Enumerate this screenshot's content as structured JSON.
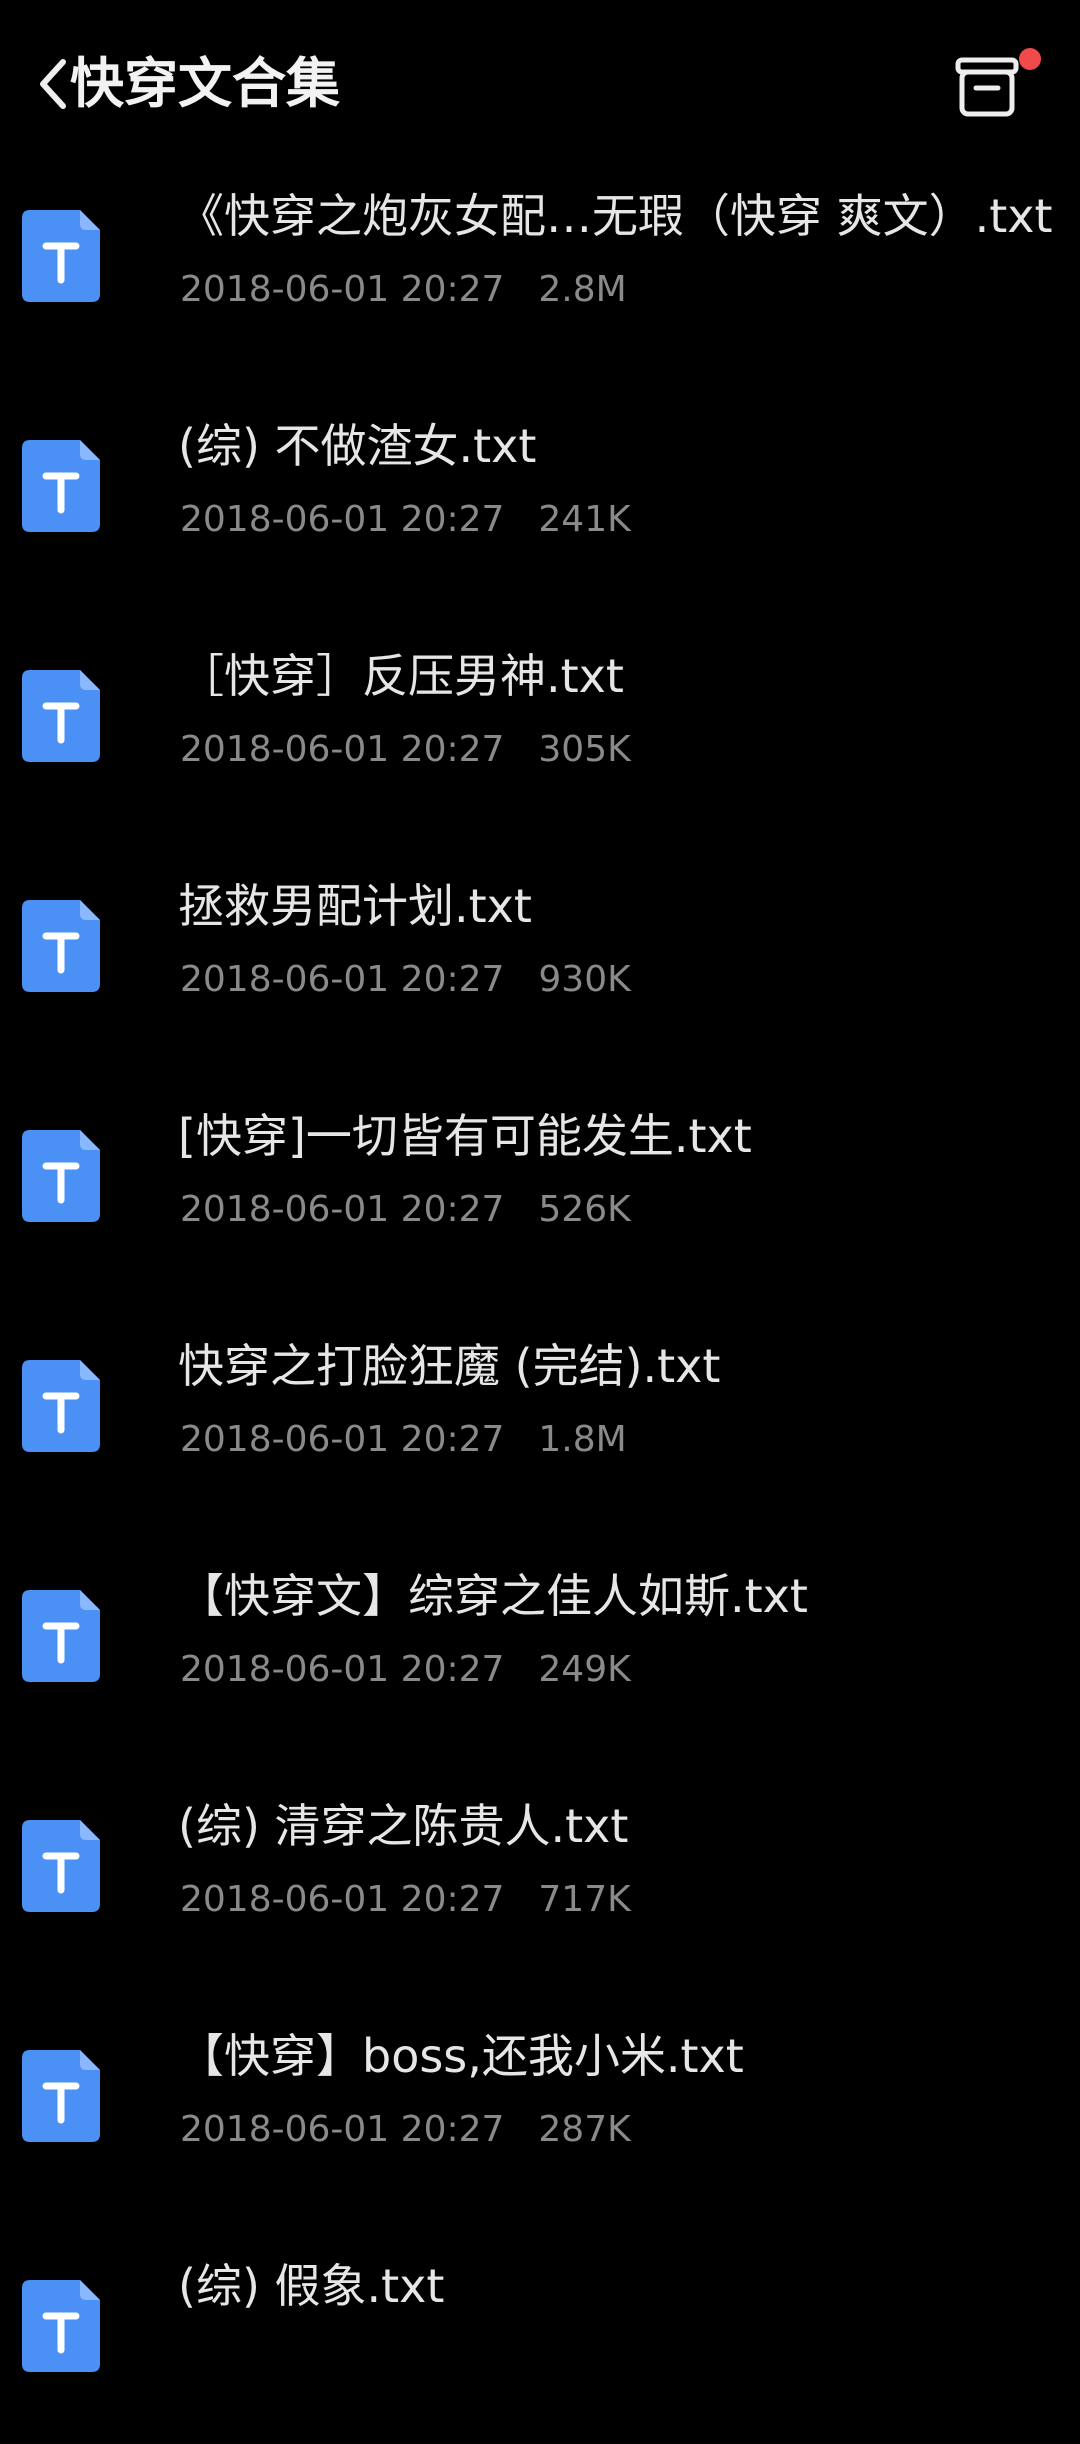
{
  "header": {
    "title": "快穿文合集",
    "back_icon": "chevron-left-icon",
    "box_icon": "box-icon",
    "accent_dot_color": "#f04a4a"
  },
  "theme": {
    "background": "#000000",
    "icon_color": "#4a90f5"
  },
  "files": [
    {
      "name": "《快穿之炮灰女配…无瑕（快穿 爽文）.txt",
      "date": "2018-06-01 20:27",
      "size": "2.8M"
    },
    {
      "name": "(综) 不做渣女.txt",
      "date": "2018-06-01 20:27",
      "size": "241K"
    },
    {
      "name": "［快穿］反压男神.txt",
      "date": "2018-06-01 20:27",
      "size": "305K"
    },
    {
      "name": "拯救男配计划.txt",
      "date": "2018-06-01 20:27",
      "size": "930K"
    },
    {
      "name": "[快穿]一切皆有可能发生.txt",
      "date": "2018-06-01 20:27",
      "size": "526K"
    },
    {
      "name": "快穿之打脸狂魔 (完结).txt",
      "date": "2018-06-01 20:27",
      "size": "1.8M"
    },
    {
      "name": "【快穿文】综穿之佳人如斯.txt",
      "date": "2018-06-01 20:27",
      "size": "249K"
    },
    {
      "name": "(综) 清穿之陈贵人.txt",
      "date": "2018-06-01 20:27",
      "size": "717K"
    },
    {
      "name": "【快穿】boss,还我小米.txt",
      "date": "2018-06-01 20:27",
      "size": "287K"
    },
    {
      "name": "(综) 假象.txt",
      "date": "",
      "size": ""
    }
  ]
}
